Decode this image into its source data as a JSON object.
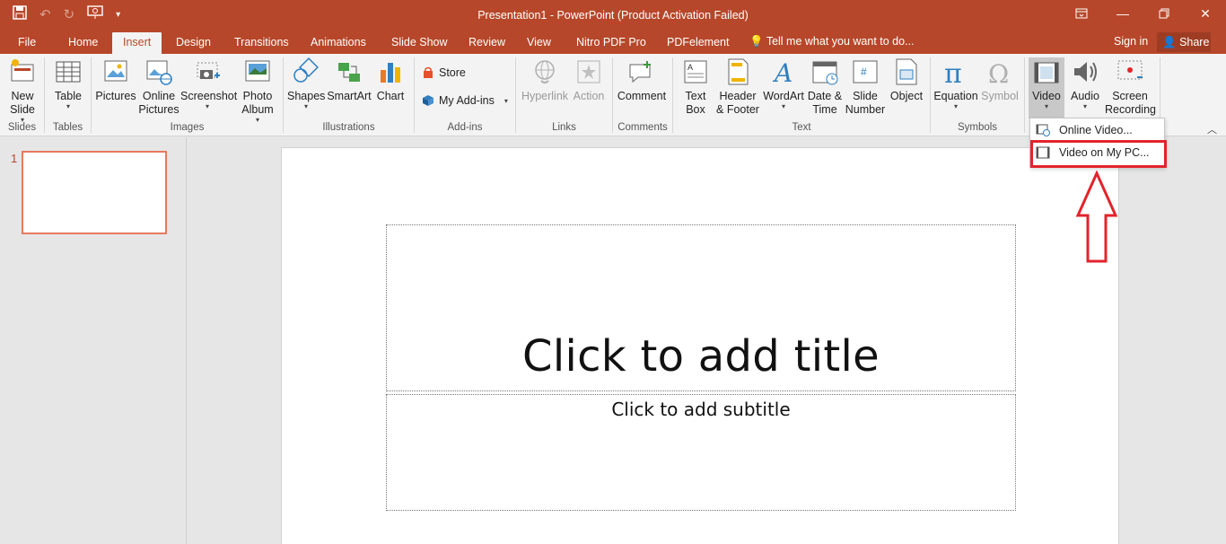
{
  "title_bar": {
    "title": "Presentation1 - PowerPoint (Product Activation Failed)",
    "qat_icons": [
      "save-icon",
      "undo-icon",
      "redo-icon",
      "present-from-start-icon",
      "customize-qat-icon"
    ],
    "window_controls": [
      "ribbon-display-icon",
      "minimize-icon",
      "restore-icon",
      "close-icon"
    ]
  },
  "tabs": [
    {
      "label": "File"
    },
    {
      "label": "Home"
    },
    {
      "label": "Insert"
    },
    {
      "label": "Design"
    },
    {
      "label": "Transitions"
    },
    {
      "label": "Animations"
    },
    {
      "label": "Slide Show"
    },
    {
      "label": "Review"
    },
    {
      "label": "View"
    },
    {
      "label": "Nitro PDF Pro"
    },
    {
      "label": "PDFelement"
    }
  ],
  "tell_me": "Tell me what you want to do...",
  "sign_in": "Sign in",
  "share": "Share",
  "ribbon": {
    "new_slide": "New Slide",
    "table": "Table",
    "pictures": "Pictures",
    "online_pictures": "Online Pictures",
    "screenshot": "Screenshot",
    "photo_album": "Photo Album",
    "shapes": "Shapes",
    "smartart": "SmartArt",
    "chart": "Chart",
    "store": "Store",
    "my_addins": "My Add-ins",
    "hyperlink": "Hyperlink",
    "action": "Action",
    "comment": "Comment",
    "text_box": "Text Box",
    "header_footer": "Header & Footer",
    "wordart": "WordArt",
    "date_time": "Date & Time",
    "slide_number": "Slide Number",
    "object": "Object",
    "equation": "Equation",
    "symbol": "Symbol",
    "video": "Video",
    "audio": "Audio",
    "screen_recording": "Screen Recording",
    "groups": {
      "slides": "Slides",
      "tables": "Tables",
      "images": "Images",
      "illustrations": "Illustrations",
      "addins": "Add-ins",
      "links": "Links",
      "comments": "Comments",
      "text": "Text",
      "symbols": "Symbols"
    }
  },
  "video_menu": {
    "online_video": "Online Video...",
    "video_on_pc": "Video on My PC..."
  },
  "slides_pane": {
    "slide_number": "1"
  },
  "slide": {
    "title_placeholder": "Click to add title",
    "subtitle_placeholder": "Click to add subtitle"
  },
  "colors": {
    "accent": "#b7472a",
    "highlight": "#e3232b"
  }
}
